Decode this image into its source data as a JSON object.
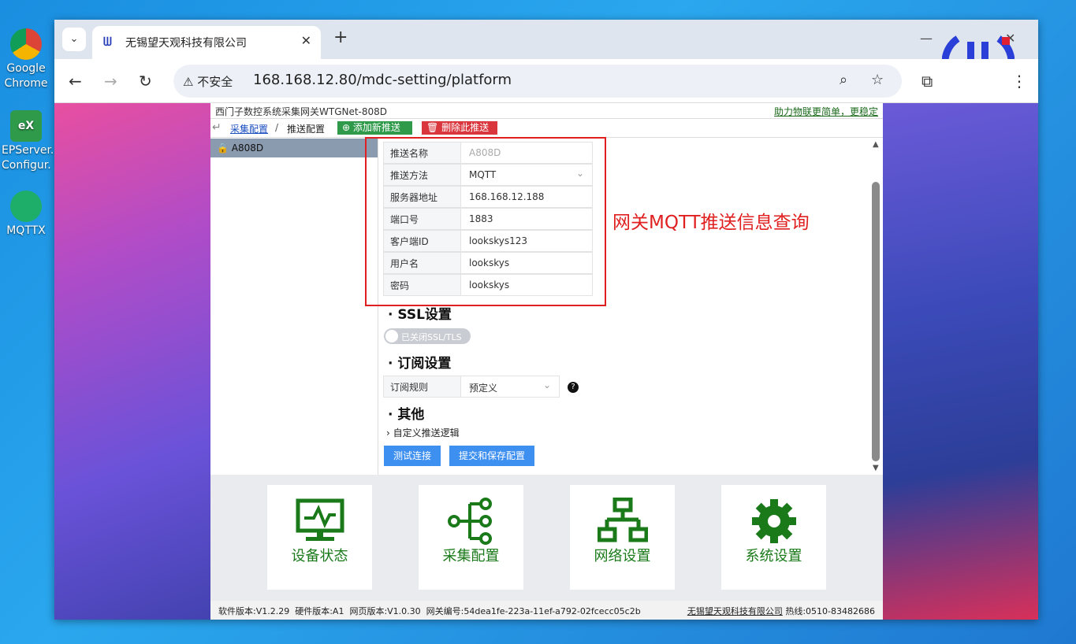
{
  "desktop": {
    "icons": [
      {
        "label": "Google Chrome"
      },
      {
        "label": "EPServer. Configur."
      },
      {
        "label": "MQTTX"
      }
    ]
  },
  "browser": {
    "tab": {
      "title": "无锡望天观科技有限公司",
      "close": "✕"
    },
    "new_tab": "+",
    "nav": {
      "back": "←",
      "forward": "→",
      "reload": "↻"
    },
    "address": {
      "security": "不安全",
      "url": "168.168.12.80/mdc-setting/platform"
    }
  },
  "app": {
    "header_title": "西门子数控系统采集网关WTGNet-808D",
    "header_slogan": "助力物联更简单，更稳定",
    "breadcrumb": {
      "back": "↵",
      "parent": "采集配置",
      "sep": "/",
      "current": "推送配置"
    },
    "add_push_label": "添加新推送",
    "delete_push_label": "删除此推送",
    "sidebar": {
      "items": [
        {
          "label": "A808D"
        }
      ]
    },
    "form": [
      {
        "label": "推送名称",
        "value": "A808D"
      },
      {
        "label": "推送方法",
        "value": "MQTT"
      },
      {
        "label": "服务器地址",
        "value": "168.168.12.188"
      },
      {
        "label": "端口号",
        "value": "1883"
      },
      {
        "label": "客户端ID",
        "value": "lookskys123"
      },
      {
        "label": "用户名",
        "value": "lookskys"
      },
      {
        "label": "密码",
        "value": "lookskys"
      }
    ],
    "annotation": "网关MQTT推送信息查询",
    "ssl": {
      "title": "· SSL设置",
      "toggle_label": "已关闭SSL/TLS"
    },
    "subscribe": {
      "title": "· 订阅设置",
      "label": "订阅规则",
      "value": "预定义"
    },
    "other": {
      "title": "· 其他",
      "expand_label": "自定义推送逻辑"
    },
    "test_button": "测试连接",
    "save_button": "提交和保存配置",
    "dock": [
      {
        "label": "设备状态"
      },
      {
        "label": "采集配置"
      },
      {
        "label": "网络设置"
      },
      {
        "label": "系统设置"
      }
    ],
    "footer": {
      "software": "软件版本:V1.2.29",
      "hardware": "硬件版本:A1",
      "web": "网页版本:V1.0.30",
      "gateway": "网关编号:54dea1fe-223a-11ef-a792-02fcecc05c2b",
      "company": "无锡望天观科技有限公司",
      "hotline": "热线:0510-83482686"
    }
  },
  "colors": {
    "accent_green": "#1a7a1a",
    "delete_red": "#d9363e",
    "primary_blue": "#3d8ff0",
    "annotation_red": "#e02020"
  }
}
